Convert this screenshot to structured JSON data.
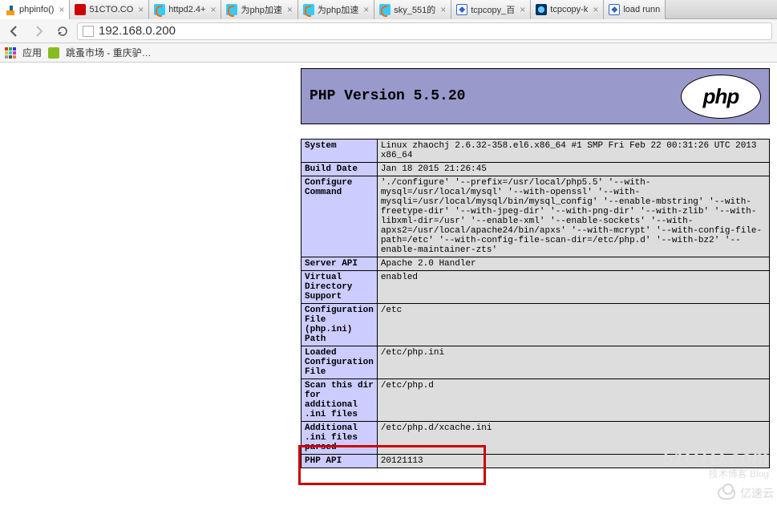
{
  "tabs": [
    {
      "label": "phpinfo()",
      "icon": "pma"
    },
    {
      "label": "51CTO.CO",
      "icon": "51cto"
    },
    {
      "label": "httpd2.4+",
      "icon": "moz"
    },
    {
      "label": "为php加速",
      "icon": "moz"
    },
    {
      "label": "为php加速",
      "icon": "moz"
    },
    {
      "label": "sky_551的",
      "icon": "moz"
    },
    {
      "label": "tcpcopy_百",
      "icon": "baidu"
    },
    {
      "label": "tcpcopy-k",
      "icon": "tcp"
    },
    {
      "label": "load runn",
      "icon": "baidu"
    }
  ],
  "url": "192.168.0.200",
  "bookmarks": {
    "apps": "应用",
    "item1": "跳蚤市场 - 重庆驴…"
  },
  "php_version_title": "PHP Version 5.5.20",
  "php_logo_text": "php",
  "rows": [
    {
      "k": "System",
      "v": "Linux zhaochj 2.6.32-358.el6.x86_64 #1 SMP Fri Feb 22 00:31:26 UTC 2013 x86_64"
    },
    {
      "k": "Build Date",
      "v": "Jan 18 2015 21:26:45"
    },
    {
      "k": "Configure Command",
      "v": "'./configure' '--prefix=/usr/local/php5.5' '--with-mysql=/usr/local/mysql' '--with-openssl' '--with-mysqli=/usr/local/mysql/bin/mysql_config' '--enable-mbstring' '--with-freetype-dir' '--with-jpeg-dir' '--with-png-dir' '--with-zlib' '--with-libxml-dir=/usr' '--enable-xml' '--enable-sockets' '--with-apxs2=/usr/local/apache24/bin/apxs' '--with-mcrypt' '--with-config-file-path=/etc' '--with-config-file-scan-dir=/etc/php.d' '--with-bz2' '--enable-maintainer-zts'"
    },
    {
      "k": "Server API",
      "v": "Apache 2.0 Handler"
    },
    {
      "k": "Virtual Directory Support",
      "v": "enabled"
    },
    {
      "k": "Configuration File (php.ini) Path",
      "v": "/etc"
    },
    {
      "k": "Loaded Configuration File",
      "v": "/etc/php.ini"
    },
    {
      "k": "Scan this dir for additional .ini files",
      "v": "/etc/php.d"
    },
    {
      "k": "Additional .ini files parsed",
      "v": "/etc/php.d/xcache.ini"
    },
    {
      "k": "PHP API",
      "v": "20121113"
    }
  ],
  "watermark": {
    "main": "51CTO.com",
    "sub": "技术博客  Blog",
    "brand": "亿速云"
  }
}
